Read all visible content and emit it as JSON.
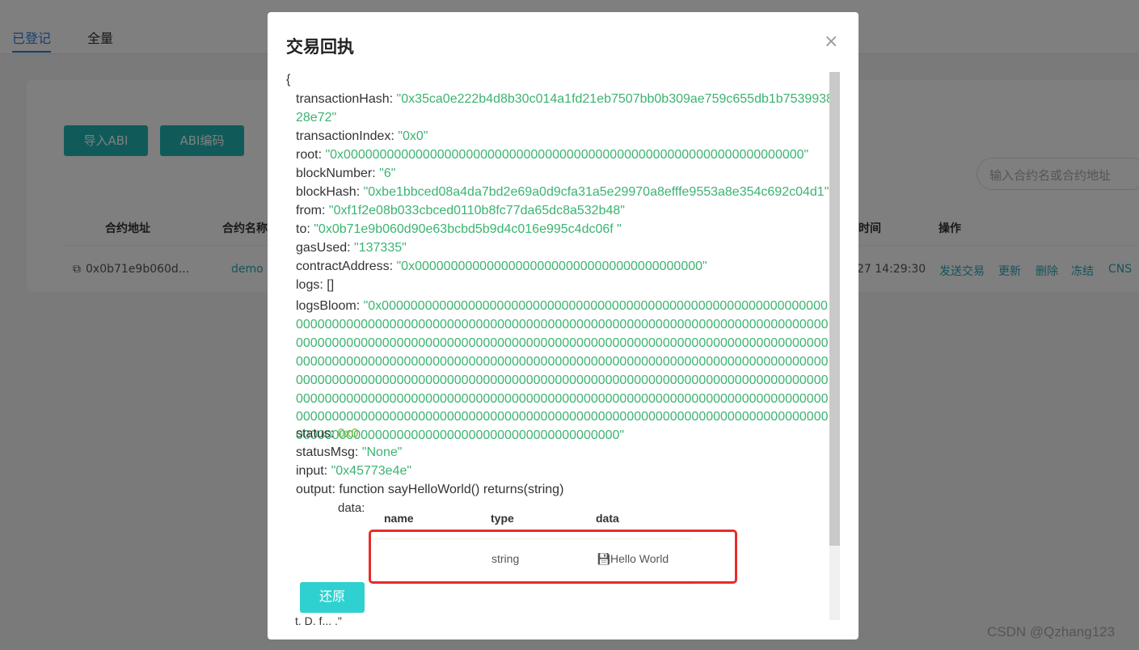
{
  "tabs": {
    "registered": "已登记",
    "all": "全量"
  },
  "toolbar": {
    "import_abi": "导入ABI",
    "abi_encode": "ABI编码"
  },
  "search": {
    "placeholder": "输入合约名或合约地址"
  },
  "table": {
    "headers": {
      "address": "合约地址",
      "name": "合约名称",
      "time": "时间",
      "actions": "操作"
    },
    "row": {
      "address": "0x0b71e9b060d...",
      "name": "demo",
      "time": "27 14:29:30",
      "actions": [
        "发送交易",
        "更新",
        "删除",
        "冻结",
        "CNS"
      ]
    }
  },
  "modal": {
    "title": "交易回执",
    "close": "×",
    "open_brace": "{",
    "fields": {
      "transactionHash_key": "transactionHash: ",
      "transactionHash_1": "\"0x35ca0e222b4d8b30c014a1fd21eb7507bb0b309ae759c655db1b7539938",
      "transactionHash_2": "28e72\"",
      "transactionIndex_key": "transactionIndex: ",
      "transactionIndex": "\"0x0\"",
      "root_key": "root: ",
      "root": "\"0x0000000000000000000000000000000000000000000000000000000000000000\"",
      "blockNumber_key": "blockNumber: ",
      "blockNumber": "\"6\"",
      "blockHash_key": "blockHash: ",
      "blockHash": "\"0xbe1bbced08a4da7bd2e69a0d9cfa31a5e29970a8efffe9553a8e354c692c04d1\"",
      "from_key": "from: ",
      "from": "\"0xf1f2e08b033cbced0110b8fc77da65dc8a532b48\"",
      "to_key": "to: ",
      "to": "\"0x0b71e9b060d90e63bcbd5b9d4c016e995c4dc06f \"",
      "gasUsed_key": "gasUsed: ",
      "gasUsed": "\"137335\"",
      "contractAddress_key": "contractAddress: ",
      "contractAddress": "\"0x0000000000000000000000000000000000000000\"",
      "logs": "logs: []",
      "logsBloom_key": "logsBloom: ",
      "logsBloom": "\"0x00000000000000000000000000000000000000000000000000000000000000000000000000000000000000000000000000000000000000000000000000000000000000000000000000000000000000000000000000000000000000000000000000000000000000000000000000000000000000000000000000000000000000000000000000000000000000000000000000000000000000000000000000000000000000000000000000000000000000000000000000000000000000000000000000000000000000000000000000000000000000000000000000000000000000000000000000000000000000000000000000000000000000000000000000000000000000000000000000000000000000000000000\"",
      "status_key": "status: ",
      "status": "0x0",
      "statusMsg_key": "statusMsg: ",
      "statusMsg": "\"None\"",
      "input_key": "input: ",
      "input": "\"0x45773e4e\"",
      "output": "output: function  sayHelloWorld() returns(string)",
      "data_label": "data:"
    },
    "output_table": {
      "headers": {
        "name": "name",
        "type": "type",
        "data": "data"
      },
      "row": {
        "name": "",
        "type": "string",
        "data": "Hello World"
      }
    },
    "restore_button": "还原",
    "cut_text": "t. D. f... .\""
  },
  "watermark": "CSDN @Qzhang123",
  "colors": {
    "accent": "#20b6b2",
    "value_green": "#3cb371",
    "highlight": "#e82b2b"
  }
}
